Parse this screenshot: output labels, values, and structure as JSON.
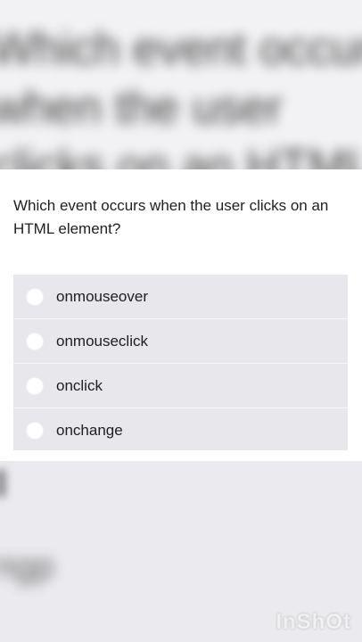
{
  "question": {
    "text": "Which event occurs when the user clicks on an HTML element?"
  },
  "options": [
    {
      "label": "onmouseover",
      "selected": false
    },
    {
      "label": "onmouseclick",
      "selected": false
    },
    {
      "label": "onclick",
      "selected": false
    },
    {
      "label": "onchange",
      "selected": false
    }
  ],
  "watermark": "InShOt",
  "colors": {
    "options_background": "#e7e7ec",
    "card_background": "#ffffff",
    "radio_fill": "#ffffff"
  }
}
